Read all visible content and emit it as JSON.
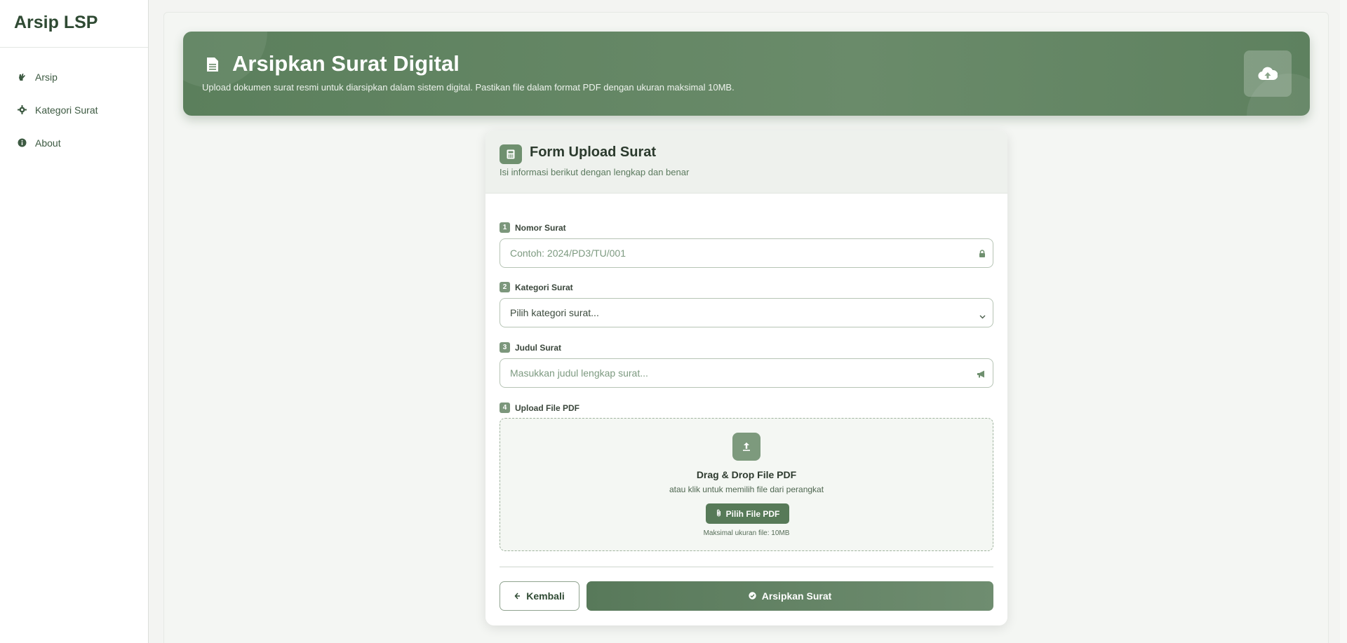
{
  "sidebar": {
    "brand": "Arsip LSP",
    "items": [
      {
        "label": "Arsip",
        "icon": "hand-icon"
      },
      {
        "label": "Kategori Surat",
        "icon": "gear-icon"
      },
      {
        "label": "About",
        "icon": "info-icon"
      }
    ]
  },
  "hero": {
    "title": "Arsipkan Surat Digital",
    "subtitle": "Upload dokumen surat resmi untuk diarsipkan dalam sistem digital. Pastikan file dalam format PDF dengan ukuran maksimal 10MB."
  },
  "form": {
    "title": "Form Upload Surat",
    "subtitle": "Isi informasi berikut dengan lengkap dan benar",
    "fields": [
      {
        "num": "1",
        "label": "Nomor Surat",
        "placeholder": "Contoh: 2024/PD3/TU/001"
      },
      {
        "num": "2",
        "label": "Kategori Surat",
        "value": "Pilih kategori surat..."
      },
      {
        "num": "3",
        "label": "Judul Surat",
        "placeholder": "Masukkan judul lengkap surat..."
      },
      {
        "num": "4",
        "label": "Upload File PDF"
      }
    ],
    "dropzone": {
      "title": "Drag & Drop File PDF",
      "subtitle": "atau klik untuk memilih file dari perangkat",
      "button": "Pilih File PDF",
      "note": "Maksimal ukuran file: 10MB"
    },
    "back_label": "Kembali",
    "submit_label": "Arsipkan Surat"
  },
  "colors": {
    "accent": "#5b7f5c",
    "accent_light": "#7d9a7d"
  }
}
